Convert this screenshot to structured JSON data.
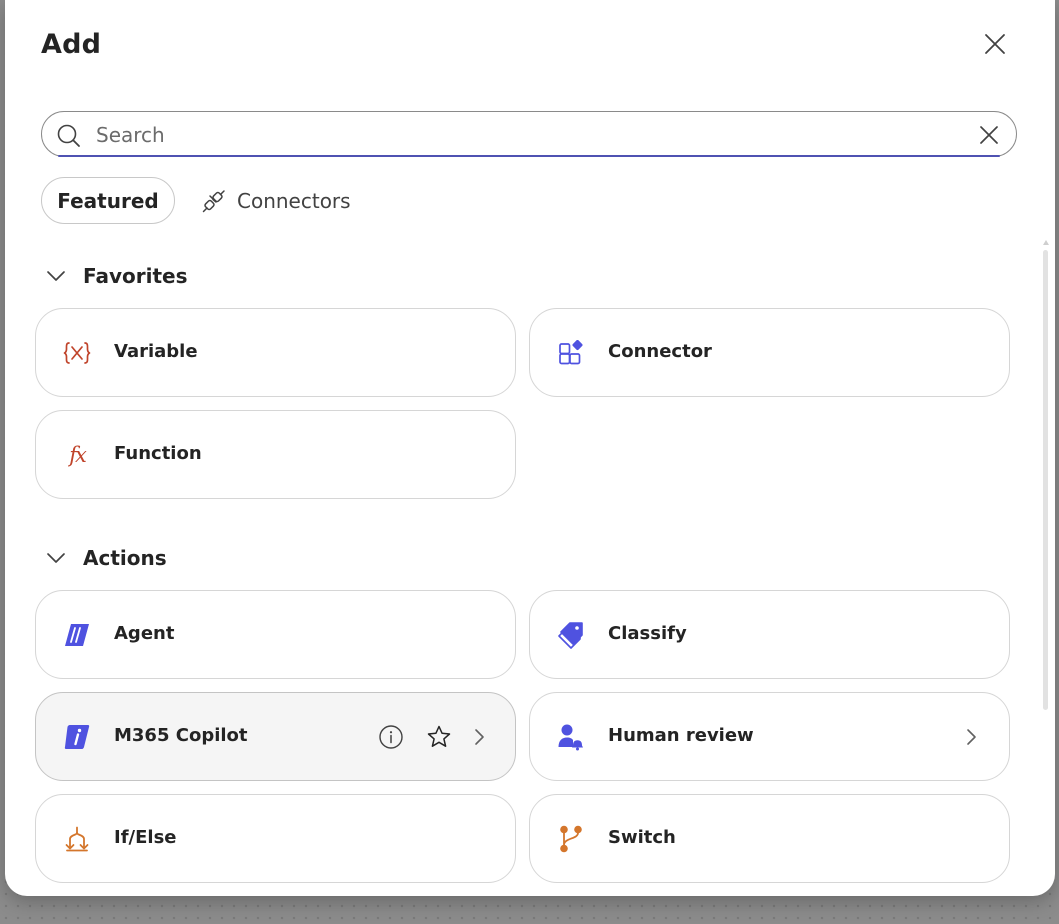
{
  "dialog": {
    "title": "Add",
    "close_icon": "close-icon"
  },
  "search": {
    "placeholder": "Search",
    "value": "",
    "search_icon": "search-icon",
    "clear_icon": "clear-icon"
  },
  "tabs": [
    {
      "label": "Featured",
      "selected": true
    },
    {
      "label": "Connectors",
      "icon": "plug-icon",
      "selected": false
    }
  ],
  "sections": {
    "favorites": {
      "label": "Favorites",
      "expanded": true,
      "items": [
        {
          "label": "Variable",
          "icon": "variable-icon",
          "icon_color": "#c0442b"
        },
        {
          "label": "Connector",
          "icon": "connector-icon",
          "icon_color": "#4f52e0"
        },
        {
          "label": "Function",
          "icon": "function-icon",
          "icon_color": "#c0442b",
          "glyph": "fx"
        }
      ]
    },
    "actions": {
      "label": "Actions",
      "expanded": true,
      "items": [
        {
          "label": "Agent",
          "icon": "agent-icon",
          "icon_color": "#4f52e0"
        },
        {
          "label": "Classify",
          "icon": "classify-tag-icon",
          "icon_color": "#4f52e0"
        },
        {
          "label": "M365 Copilot",
          "icon": "copilot-icon",
          "icon_color": "#4f52e0",
          "hovered": true,
          "actions": [
            "info-icon",
            "star-icon",
            "chevron-right-icon"
          ]
        },
        {
          "label": "Human review",
          "icon": "human-review-icon",
          "icon_color": "#4f52e0",
          "actions": [
            "chevron-right-icon"
          ]
        },
        {
          "label": "If/Else",
          "icon": "if-else-icon",
          "icon_color": "#d4762c"
        },
        {
          "label": "Switch",
          "icon": "switch-icon",
          "icon_color": "#d4762c"
        }
      ]
    }
  },
  "colors": {
    "accent": "#4f52b2",
    "brand_blue": "#4f52e0",
    "variable_red": "#c0442b",
    "flow_orange": "#d4762c"
  }
}
